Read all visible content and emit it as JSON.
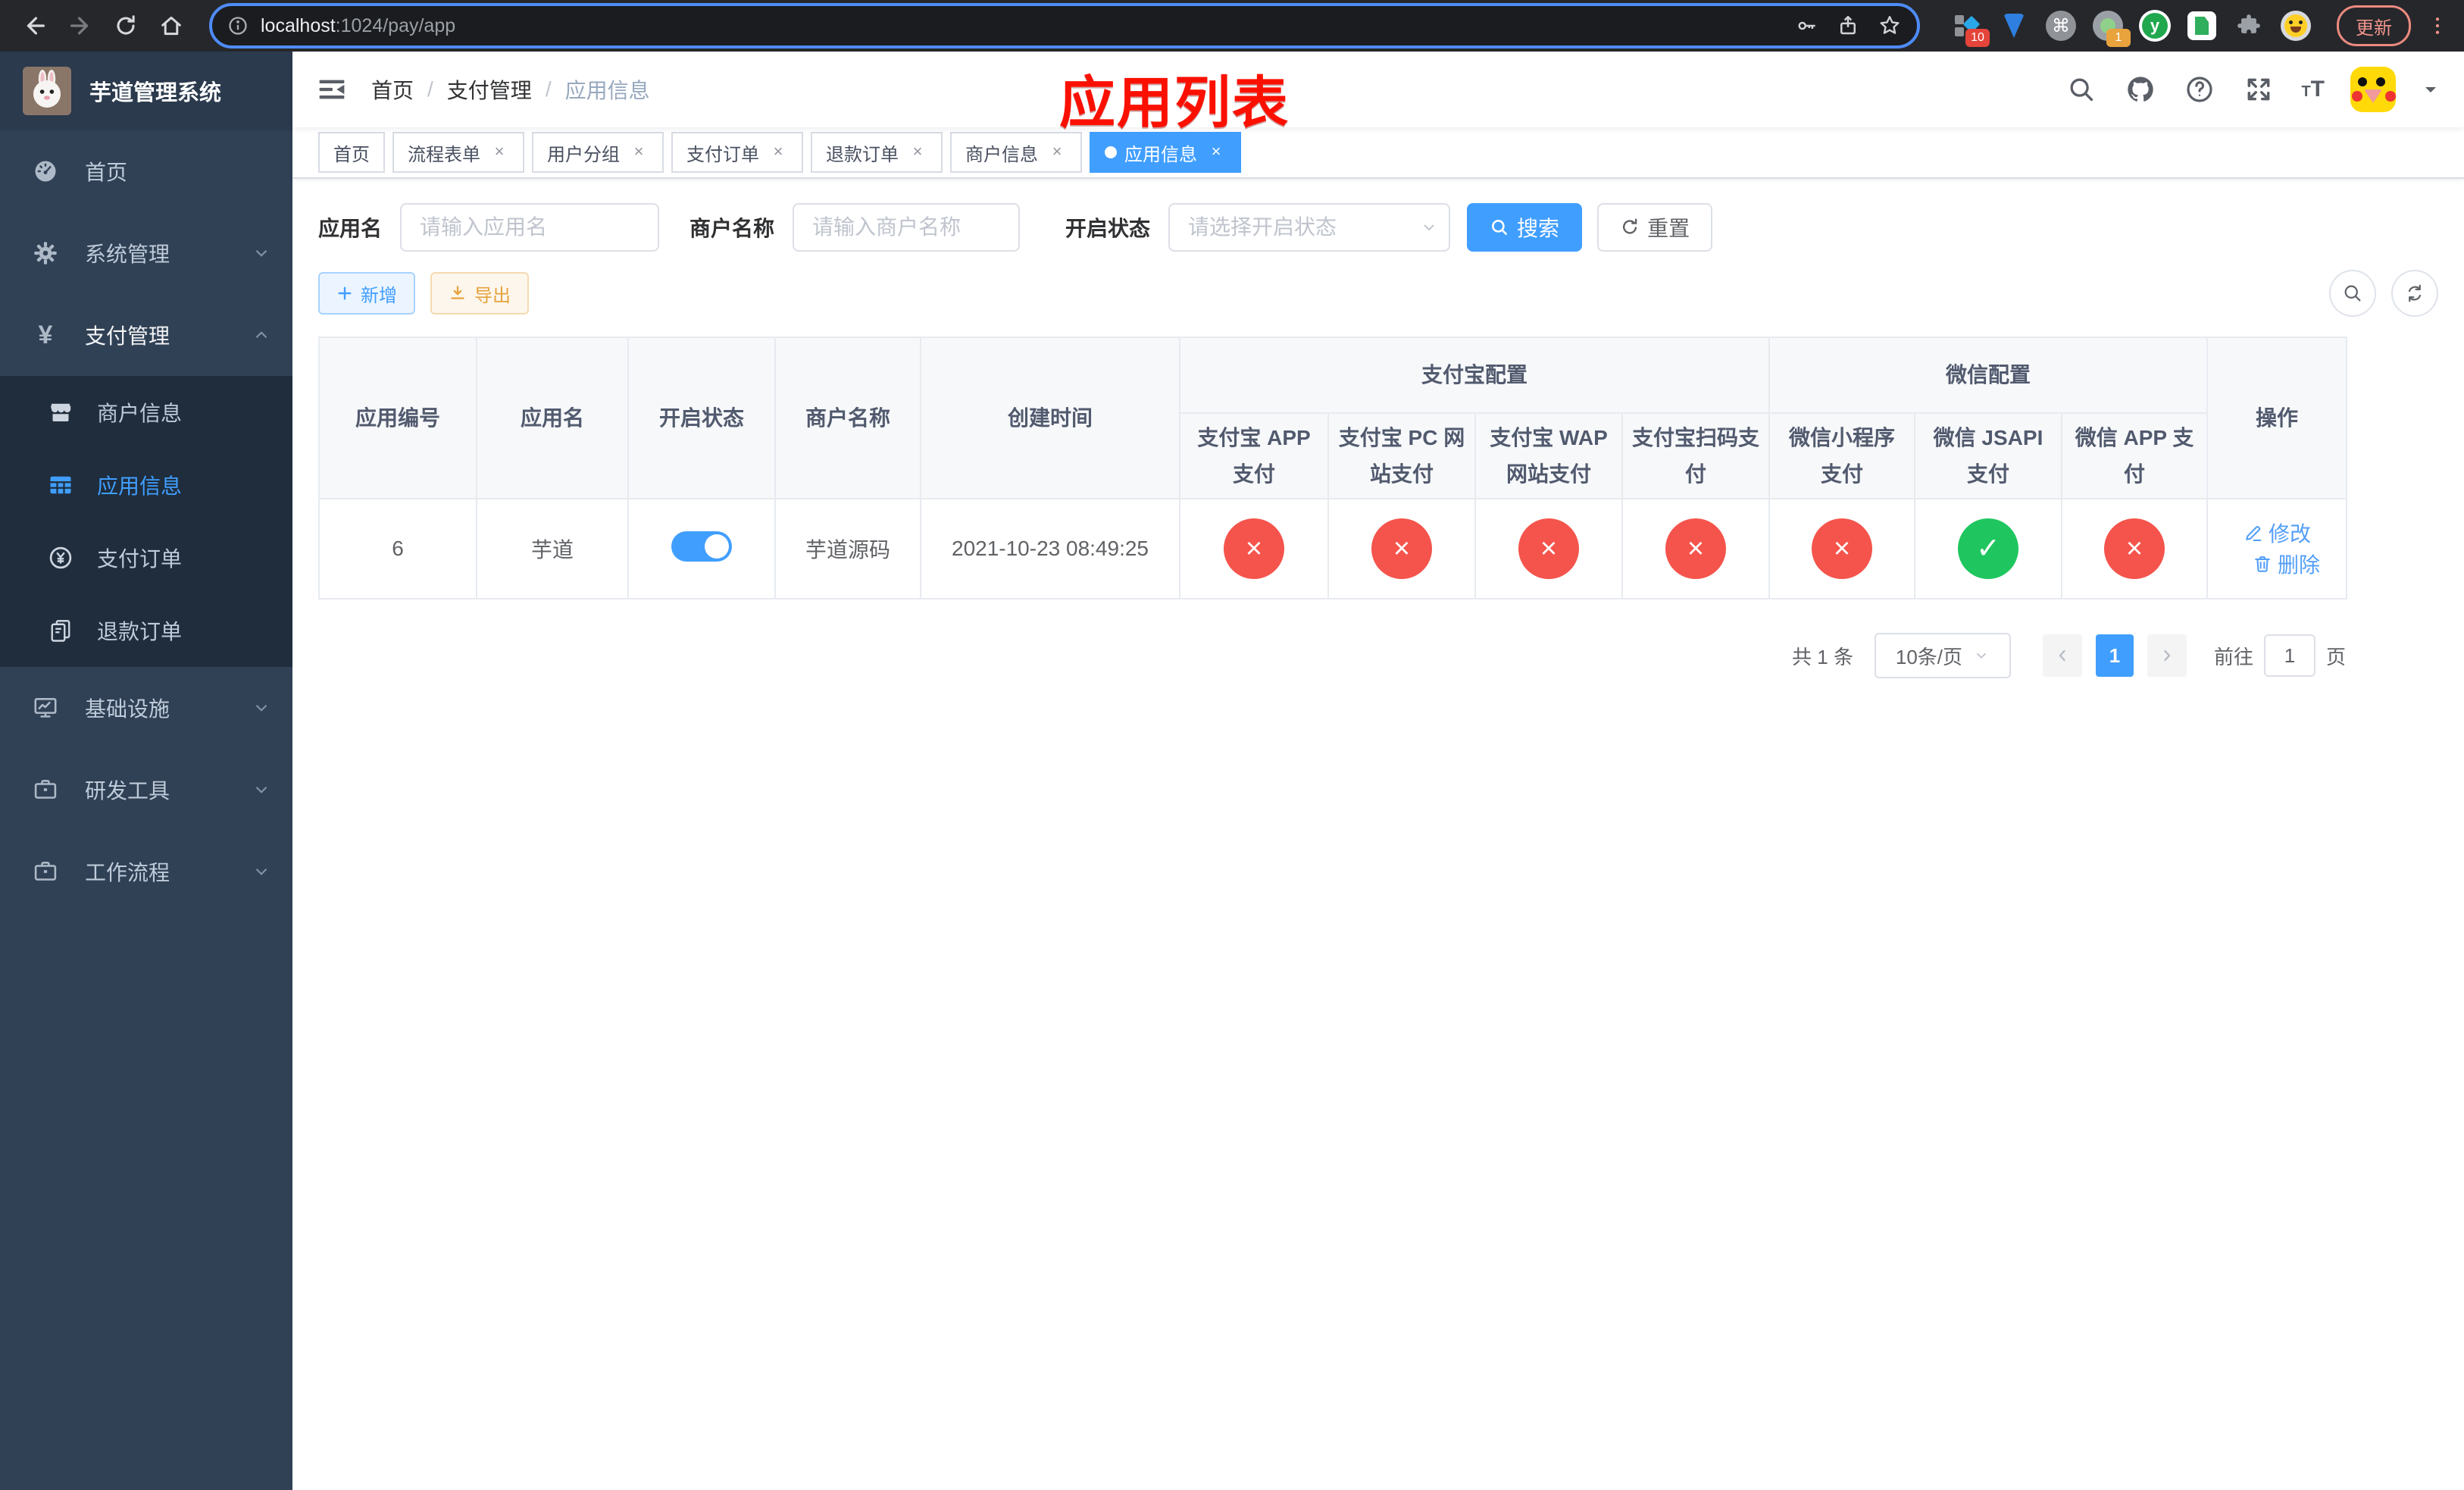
{
  "colors": {
    "accent": "#409eff",
    "danger": "#f4544c",
    "success": "#1fc65f",
    "warning": "#e6a23c",
    "sidebar_bg": "#304156",
    "submenu_bg": "#1f2d3d",
    "annotation_red": "#fb1000"
  },
  "browser": {
    "url_host": "localhost",
    "url_rest": ":1024/pay/app",
    "ext_badge_grid": "10",
    "ext_badge_cam": "1",
    "ext_y_letter": "y",
    "ext_cmd": "⌘",
    "update_label": "更新"
  },
  "sidebar": {
    "title": "芋道管理系统",
    "menu_top": [
      {
        "label": "首页",
        "icon": "dashboard-icon",
        "expandable": false,
        "expanded": false
      },
      {
        "label": "系统管理",
        "icon": "gear-icon",
        "expandable": true,
        "expanded": false
      },
      {
        "label": "支付管理",
        "icon": "yen-icon",
        "expandable": true,
        "expanded": true
      }
    ],
    "submenu": [
      {
        "label": "商户信息",
        "icon": "shop-icon",
        "active": false
      },
      {
        "label": "应用信息",
        "icon": "grid-icon",
        "active": true
      },
      {
        "label": "支付订单",
        "icon": "yen-circle-icon",
        "active": false
      },
      {
        "label": "退款订单",
        "icon": "document-icon",
        "active": false
      }
    ],
    "menu_bottom": [
      {
        "label": "基础设施",
        "icon": "monitor-icon",
        "expandable": true,
        "expanded": false
      },
      {
        "label": "研发工具",
        "icon": "toolbox-icon",
        "expandable": true,
        "expanded": false
      },
      {
        "label": "工作流程",
        "icon": "briefcase-icon",
        "expandable": true,
        "expanded": false
      }
    ]
  },
  "header": {
    "breadcrumb": [
      "首页",
      "支付管理",
      "应用信息"
    ],
    "annotation": "应用列表",
    "right_icons": [
      "search-icon",
      "github-icon",
      "question-icon",
      "fullscreen-icon",
      "font-size-icon"
    ]
  },
  "tabs": [
    {
      "label": "首页",
      "closable": false,
      "active": false
    },
    {
      "label": "流程表单",
      "closable": true,
      "active": false
    },
    {
      "label": "用户分组",
      "closable": true,
      "active": false
    },
    {
      "label": "支付订单",
      "closable": true,
      "active": false
    },
    {
      "label": "退款订单",
      "closable": true,
      "active": false
    },
    {
      "label": "商户信息",
      "closable": true,
      "active": false
    },
    {
      "label": "应用信息",
      "closable": true,
      "active": true
    }
  ],
  "filter": {
    "app_name_label": "应用名",
    "app_name_placeholder": "请输入应用名",
    "merchant_label": "商户名称",
    "merchant_placeholder": "请输入商户名称",
    "status_label": "开启状态",
    "status_placeholder": "请选择开启状态",
    "search_label": "搜索",
    "reset_label": "重置"
  },
  "toolbar": {
    "add_label": "新增",
    "export_label": "导出"
  },
  "table": {
    "columns_simple": [
      "应用编号",
      "应用名",
      "开启状态",
      "商户名称",
      "创建时间"
    ],
    "group_alipay": "支付宝配置",
    "group_wechat": "微信配置",
    "alipay_cols": [
      "支付宝 APP 支付",
      "支付宝 PC 网站支付",
      "支付宝 WAP 网站支付",
      "支付宝扫码支付"
    ],
    "wechat_cols": [
      "微信小程序支付",
      "微信 JSAPI 支付",
      "微信 APP 支付"
    ],
    "ops_col": "操作",
    "row": {
      "id": "6",
      "name": "芋道",
      "enabled": true,
      "merchant": "芋道源码",
      "created": "2021-10-23 08:49:25",
      "configs": [
        false,
        false,
        false,
        false,
        false,
        true,
        false
      ],
      "edit_label": "修改",
      "delete_label": "删除"
    }
  },
  "pagination": {
    "total_text": "共 1 条",
    "page_size": "10条/页",
    "current_page": "1",
    "goto_label": "前往",
    "goto_value": "1",
    "page_suffix": "页"
  }
}
